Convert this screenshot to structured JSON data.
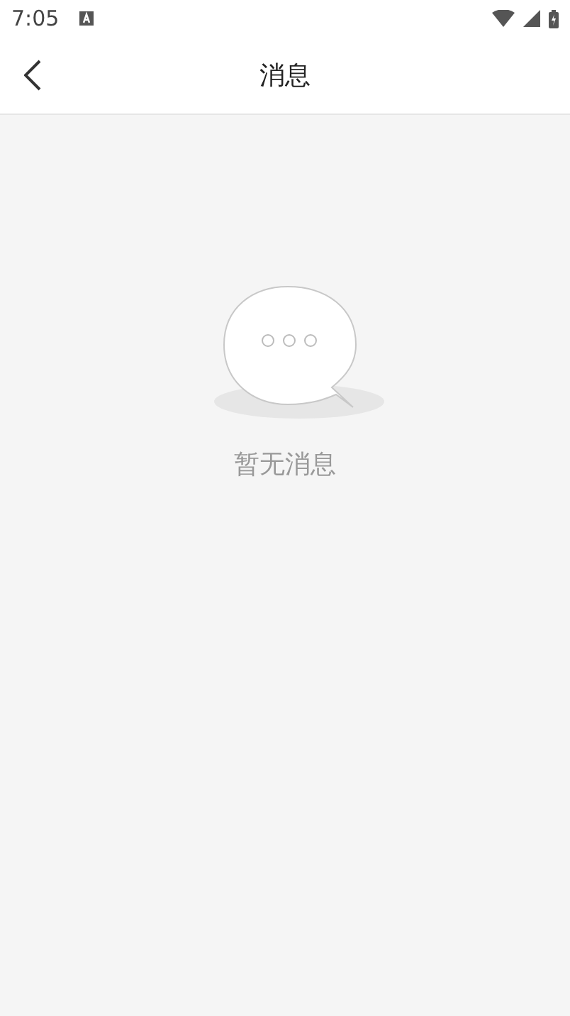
{
  "status_bar": {
    "time": "7:05"
  },
  "header": {
    "title": "消息"
  },
  "empty_state": {
    "message": "暂无消息"
  }
}
